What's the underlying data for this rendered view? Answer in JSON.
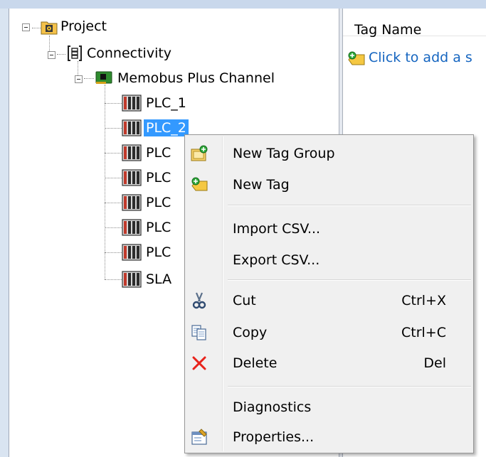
{
  "tree": {
    "project": "Project",
    "connectivity": "Connectivity",
    "channel": "Memobus Plus Channel",
    "devices": [
      "PLC_1",
      "PLC_2",
      "PLC",
      "PLC",
      "PLC",
      "PLC",
      "PLC",
      "SLA"
    ]
  },
  "list": {
    "header": "Tag Name",
    "add_row": "Click to add a s"
  },
  "context_menu": {
    "new_tag_group": "New Tag Group",
    "new_tag": "New Tag",
    "import_csv": "Import CSV...",
    "export_csv": "Export CSV...",
    "cut": "Cut",
    "cut_shortcut": "Ctrl+X",
    "copy": "Copy",
    "copy_shortcut": "Ctrl+C",
    "delete": "Delete",
    "delete_shortcut": "Del",
    "diagnostics": "Diagnostics",
    "properties": "Properties..."
  },
  "colors": {
    "selection": "#3399ff",
    "link": "#1565c0",
    "delete_icon": "#e8231b"
  }
}
